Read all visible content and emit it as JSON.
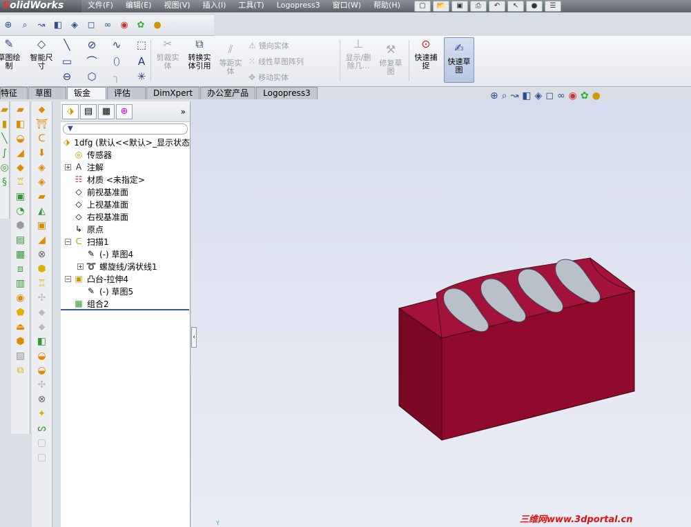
{
  "app": {
    "logo_text_red": "S",
    "logo_text": "olidWorks"
  },
  "menu": [
    "文件(F)",
    "编辑(E)",
    "视图(V)",
    "插入(I)",
    "工具(T)",
    "Logopress3",
    "窗口(W)",
    "帮助(H)"
  ],
  "ribbon": {
    "sketch": "草图绘\n制",
    "smart_dim": "智能尺\n寸",
    "trim": "剪裁实\n体",
    "convert": "转换实\n体引用",
    "offset": "等距实\n体",
    "mirror": "镜向实体",
    "linear_pattern": "线性草图阵列",
    "move": "移动实体",
    "display_delete": "显示/删\n除几...",
    "repair": "修复草\n图",
    "quick_snap": "快速捕\n捉",
    "rapid_sketch": "快速草\n图"
  },
  "tabs": [
    "特征",
    "草图",
    "钣金",
    "评估",
    "DimXpert",
    "办公室产品",
    "Logopress3"
  ],
  "active_tab": "草图",
  "tree": {
    "root": "1dfg  (默认<<默认>_显示状态",
    "items": [
      {
        "label": "传感器",
        "indent": 1,
        "expander": ""
      },
      {
        "label": "注解",
        "indent": 1,
        "expander": "+"
      },
      {
        "label": "材质 <未指定>",
        "indent": 1,
        "expander": ""
      },
      {
        "label": "前视基准面",
        "indent": 1,
        "expander": ""
      },
      {
        "label": "上视基准面",
        "indent": 1,
        "expander": ""
      },
      {
        "label": "右视基准面",
        "indent": 1,
        "expander": ""
      },
      {
        "label": "原点",
        "indent": 1,
        "expander": ""
      },
      {
        "label": "扫描1",
        "indent": 1,
        "expander": "−"
      },
      {
        "label": "(-) 草图4",
        "indent": 2,
        "expander": ""
      },
      {
        "label": "螺旋线/涡状线1",
        "indent": 2,
        "expander": "+"
      },
      {
        "label": "凸台-拉伸4",
        "indent": 1,
        "expander": "−"
      },
      {
        "label": "(-) 草图5",
        "indent": 2,
        "expander": ""
      },
      {
        "label": "组合2",
        "indent": 1,
        "expander": ""
      }
    ]
  },
  "watermark": "三维网www.3dportal.cn",
  "axis_label": "Y",
  "colors": {
    "part": "#8b0a2a",
    "part_top": "#a8143a",
    "part_front": "#6e0620",
    "groove": "#b8bfc8"
  }
}
